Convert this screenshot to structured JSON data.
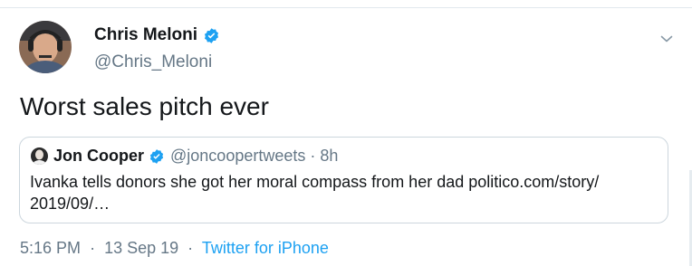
{
  "tweet": {
    "author": {
      "display_name": "Chris Meloni",
      "handle": "@Chris_Meloni",
      "verified": true
    },
    "text": "Worst sales pitch ever",
    "timestamp": {
      "time": "5:16 PM",
      "date": "13 Sep 19",
      "separator": "·",
      "source": "Twitter for iPhone"
    },
    "menu_icon": "chevron-down-icon"
  },
  "quoted_tweet": {
    "author": {
      "display_name": "Jon Cooper",
      "handle": "@joncoopertweets",
      "verified": true
    },
    "separator": "·",
    "age": "8h",
    "text": "Ivanka tells donors she got her moral compass from her dad politico.com/story/ 2019/09/…"
  },
  "colors": {
    "verified_blue": "#1da1f2",
    "link_blue": "#1da1f2",
    "secondary_text": "#657786",
    "primary_text": "#14171a",
    "card_border": "#ccd6dd"
  }
}
